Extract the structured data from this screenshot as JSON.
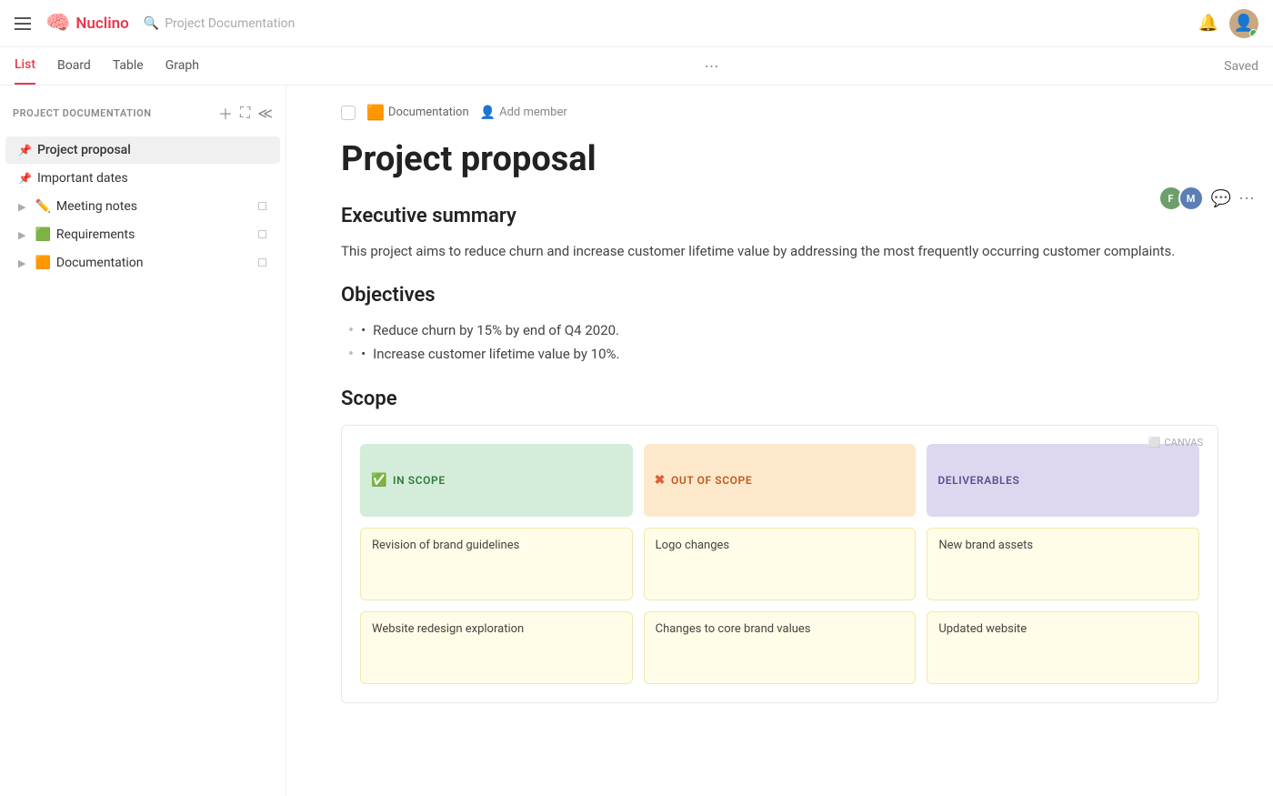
{
  "app": {
    "name": "Nuclino",
    "search_placeholder": "Project Documentation"
  },
  "tabs": [
    {
      "id": "list",
      "label": "List",
      "active": true
    },
    {
      "id": "board",
      "label": "Board",
      "active": false
    },
    {
      "id": "table",
      "label": "Table",
      "active": false
    },
    {
      "id": "graph",
      "label": "Graph",
      "active": false
    }
  ],
  "saved_label": "Saved",
  "sidebar": {
    "title": "PROJECT DOCUMENTATION",
    "items": [
      {
        "id": "project-proposal",
        "label": "Project proposal",
        "icon": "📌",
        "active": true,
        "pinned": true
      },
      {
        "id": "important-dates",
        "label": "Important dates",
        "icon": "📌",
        "active": false,
        "pinned": true
      },
      {
        "id": "meeting-notes",
        "label": "Meeting notes",
        "icon": "✏️",
        "active": false,
        "expandable": true
      },
      {
        "id": "requirements",
        "label": "Requirements",
        "icon": "🟩",
        "active": false,
        "expandable": true
      },
      {
        "id": "documentation",
        "label": "Documentation",
        "icon": "🟧",
        "active": false,
        "expandable": true
      }
    ]
  },
  "document": {
    "folder": "Documentation",
    "folder_icon": "🟧",
    "add_member_label": "Add member",
    "title": "Project proposal",
    "sections": {
      "executive_summary": {
        "heading": "Executive summary",
        "text": "This project aims to reduce churn and increase customer lifetime value by addressing the most frequently occurring customer complaints."
      },
      "objectives": {
        "heading": "Objectives",
        "items": [
          "Reduce churn by 15% by end of Q4 2020.",
          "Increase customer lifetime value by 10%."
        ]
      },
      "scope": {
        "heading": "Scope",
        "canvas_label": "CANVAS",
        "columns": [
          {
            "id": "in-scope",
            "label": "IN SCOPE",
            "type": "in-scope"
          },
          {
            "id": "out-scope",
            "label": "OUT OF SCOPE",
            "type": "out-scope"
          },
          {
            "id": "deliverables",
            "label": "DELIVERABLES",
            "type": "deliverables"
          }
        ],
        "cards": [
          [
            {
              "text": "Revision of brand guidelines"
            },
            {
              "text": "Website redesign exploration"
            }
          ],
          [
            {
              "text": "Logo changes"
            },
            {
              "text": "Changes to core brand values"
            }
          ],
          [
            {
              "text": "New brand assets"
            },
            {
              "text": "Updated website"
            }
          ]
        ]
      }
    }
  }
}
